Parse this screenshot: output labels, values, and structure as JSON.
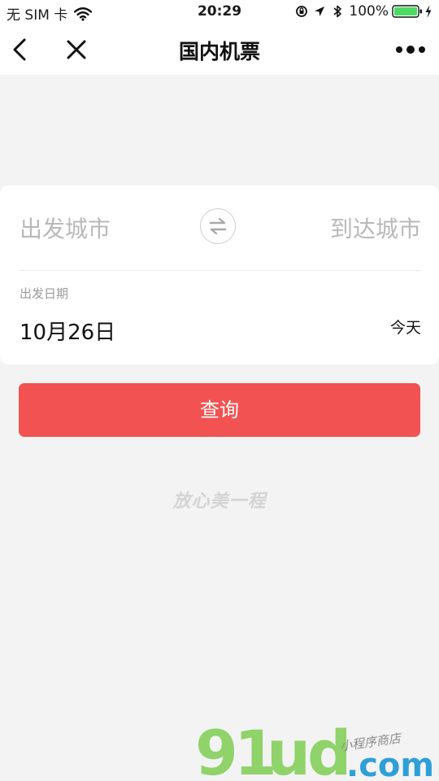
{
  "status_bar": {
    "carrier": "无 SIM 卡",
    "time": "20:29",
    "battery_percent": "100%",
    "icons": [
      "wifi-icon",
      "orientation-lock-icon",
      "location-arrow-icon",
      "bluetooth-icon",
      "battery-icon",
      "charging-icon"
    ]
  },
  "nav": {
    "title": "国内机票",
    "icons": [
      "back-chevron-icon",
      "close-icon",
      "more-dots-icon"
    ]
  },
  "search": {
    "from_city_placeholder": "出发城市",
    "to_city_placeholder": "到达城市",
    "date_label": "出发日期",
    "date_value": "10月26日",
    "date_relative": "今天",
    "submit_label": "查询",
    "swap_icon": "swap-arrows-icon"
  },
  "brand": {
    "slogan": "放心美一程"
  },
  "watermark": {
    "text": "91ud.com",
    "subtext": "小程序商店"
  },
  "colors": {
    "accent": "#f25252",
    "placeholder": "#b9b9b9",
    "background": "#f3f3f3",
    "watermark_green": "#8fd36a",
    "watermark_blue": "#2f9fd8"
  }
}
